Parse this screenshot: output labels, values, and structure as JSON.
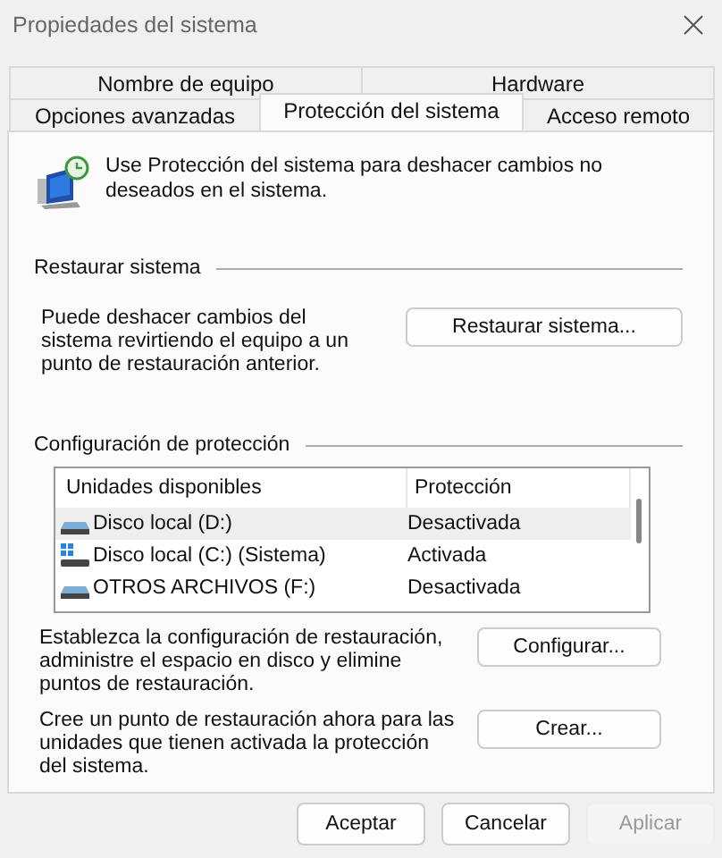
{
  "window": {
    "title": "Propiedades del sistema"
  },
  "tabs": [
    [
      {
        "label": "Nombre de equipo",
        "selected": false
      },
      {
        "label": "Hardware",
        "selected": false
      }
    ],
    [
      {
        "label": "Opciones avanzadas",
        "selected": false
      },
      {
        "label": "Protección del sistema",
        "selected": true
      },
      {
        "label": "Acceso remoto",
        "selected": false
      }
    ]
  ],
  "intro": "Use Protección del sistema para deshacer cambios no deseados en el sistema.",
  "restore": {
    "heading": "Restaurar sistema",
    "text": "Puede deshacer cambios del sistema revirtiendo el equipo a un punto de restauración anterior.",
    "button": "Restaurar sistema..."
  },
  "protection": {
    "heading": "Configuración de protección",
    "columns": [
      "Unidades disponibles",
      "Protección"
    ],
    "drives": [
      {
        "name": "Disco local (D:)",
        "kind": "drive",
        "status": "Desactivada",
        "selected": true
      },
      {
        "name": "Disco local (C:) (Sistema)",
        "kind": "system",
        "status": "Activada",
        "selected": false
      },
      {
        "name": "OTROS ARCHIVOS (F:)",
        "kind": "drive",
        "status": "Desactivada",
        "selected": false
      }
    ],
    "actions": [
      {
        "text": "Establezca la configuración de restauración, administre el espacio en disco y elimine puntos de restauración.",
        "button": "Configurar..."
      },
      {
        "text": "Cree un punto de restauración ahora para las unidades que tienen activada la protección del sistema.",
        "button": "Crear..."
      }
    ]
  },
  "buttons": [
    {
      "label": "Aceptar",
      "disabled": false
    },
    {
      "label": "Cancelar",
      "disabled": false
    },
    {
      "label": "Aplicar",
      "disabled": true
    }
  ]
}
